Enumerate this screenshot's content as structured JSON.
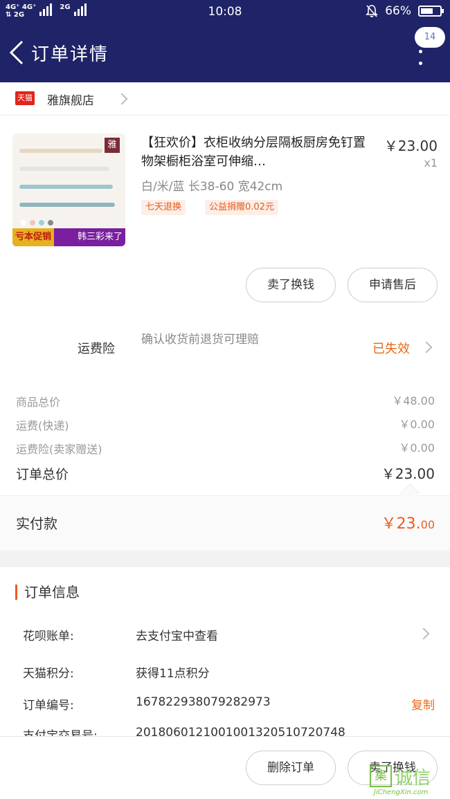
{
  "status_bar": {
    "network_top": "4G⁺ 4G⁺",
    "network_bottom": "⇅ 2G",
    "network_right": "2G",
    "time": "10:08",
    "battery": "66%",
    "battery_level": 0.66
  },
  "header": {
    "title": "订单详情",
    "badge": "14"
  },
  "store": {
    "tmall_logo": "天猫",
    "name": "雅旗舰店"
  },
  "product": {
    "title": "【狂欢价】衣柜收纳分层隔板厨房免钉置物架橱柜浴室可伸缩…",
    "price": "￥23.00",
    "qty": "x1",
    "sku": "白/米/蓝 长38-60 宽42cm",
    "tags": [
      "七天退换",
      "公益捐赠0.02元"
    ],
    "thumb_tag": "雅",
    "thumb_promo_left": "亏本促销",
    "thumb_promo_right": "韩三彩来了"
  },
  "actions": {
    "resell": "卖了换钱",
    "after_sale": "申请售后"
  },
  "insurance": {
    "label": "运费险",
    "desc": "确认收货前退货可理赔",
    "status": "已失效"
  },
  "fees": [
    {
      "label": "商品总价",
      "value": "￥48.00"
    },
    {
      "label": "运费(快递)",
      "value": "￥0.00"
    },
    {
      "label": "运费险(卖家赠送)",
      "value": "￥0.00"
    }
  ],
  "total": {
    "label": "订单总价",
    "value": "￥23.00"
  },
  "paid": {
    "label": "实付款",
    "value_main": "￥23.",
    "value_dec": "00"
  },
  "order_info": {
    "title": "订单信息",
    "rows": [
      {
        "label": "花呗账单:",
        "value": "去支付宝中查看"
      },
      {
        "label": "天猫积分:",
        "value": "获得11点积分"
      },
      {
        "label": "订单编号:",
        "value": "167822938079282973"
      },
      {
        "label": "支付宝交易号:",
        "value": "2018060121001001320510720748"
      }
    ],
    "copy": "复制"
  },
  "bottom": {
    "delete": "删除订单",
    "resell": "卖了换钱"
  },
  "watermark": {
    "box": "集",
    "cn": "诚信",
    "en": "JiChengXin.com"
  },
  "colors": {
    "header_bg": "#1f2468",
    "accent": "#f05a1e",
    "tmall_red": "#e2231a"
  }
}
